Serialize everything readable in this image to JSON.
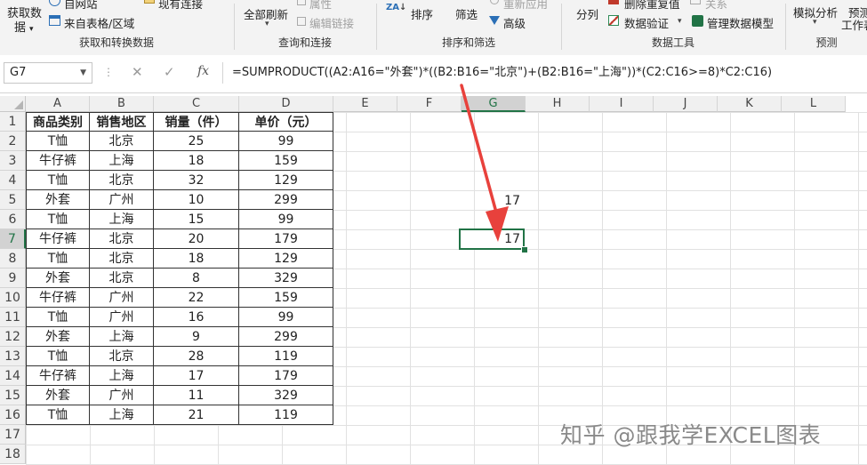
{
  "ribbon": {
    "get_data": {
      "label_line1": "获取数",
      "label_line2": "据"
    },
    "from_web": "自网站",
    "from_table": "来自表格/区域",
    "existing_conn": "现有连接",
    "properties": "属性",
    "refresh_all": "全部刷新",
    "edit_links": "编辑链接",
    "sort_az": "ZA",
    "sort": "排序",
    "filter": "筛选",
    "reapply": "重新应用",
    "advanced": "高级",
    "text_to_columns": "分列",
    "remove_duplicates": "删除重复值",
    "relations": "关系",
    "data_validation": "数据验证",
    "manage_model": "管理数据模型",
    "what_if": "模拟分析",
    "forecast_sheet_line1": "预测",
    "forecast_sheet_line2": "工作表",
    "groups": {
      "get_transform": "获取和转换数据",
      "queries": "查询和连接",
      "sort_filter": "排序和筛选",
      "data_tools": "数据工具",
      "forecast": "预测"
    }
  },
  "formula_bar": {
    "name_box": "G7",
    "cancel": "✕",
    "enter": "✓",
    "fx": "fx",
    "formula": "=SUMPRODUCT((A2:A16=\"外套\")*((B2:B16=\"北京\")+(B2:B16=\"上海\"))*(C2:C16>=8)*C2:C16)"
  },
  "columns": [
    "A",
    "B",
    "C",
    "D",
    "E",
    "F",
    "G",
    "H",
    "I",
    "J",
    "K",
    "L"
  ],
  "rows": [
    "1",
    "2",
    "3",
    "4",
    "5",
    "6",
    "7",
    "8",
    "9",
    "10",
    "11",
    "12",
    "13",
    "14",
    "15",
    "16",
    "17",
    "18"
  ],
  "table": {
    "headers": [
      "商品类别",
      "销售地区",
      "销量（件）",
      "单价（元）"
    ],
    "rows": [
      [
        "T恤",
        "北京",
        "25",
        "99"
      ],
      [
        "牛仔裤",
        "上海",
        "18",
        "159"
      ],
      [
        "T恤",
        "北京",
        "32",
        "129"
      ],
      [
        "外套",
        "广州",
        "10",
        "299"
      ],
      [
        "T恤",
        "上海",
        "15",
        "99"
      ],
      [
        "牛仔裤",
        "北京",
        "20",
        "179"
      ],
      [
        "T恤",
        "北京",
        "18",
        "129"
      ],
      [
        "外套",
        "北京",
        "8",
        "329"
      ],
      [
        "牛仔裤",
        "广州",
        "22",
        "159"
      ],
      [
        "T恤",
        "广州",
        "16",
        "99"
      ],
      [
        "外套",
        "上海",
        "9",
        "299"
      ],
      [
        "T恤",
        "北京",
        "28",
        "119"
      ],
      [
        "牛仔裤",
        "上海",
        "17",
        "179"
      ],
      [
        "外套",
        "广州",
        "11",
        "329"
      ],
      [
        "T恤",
        "上海",
        "21",
        "119"
      ]
    ]
  },
  "g5_value": "17",
  "g7_value": "17",
  "watermark": "知乎 @跟我学EXCEL图表",
  "colors": {
    "accent": "#217346",
    "arrow": "#e8413c"
  }
}
